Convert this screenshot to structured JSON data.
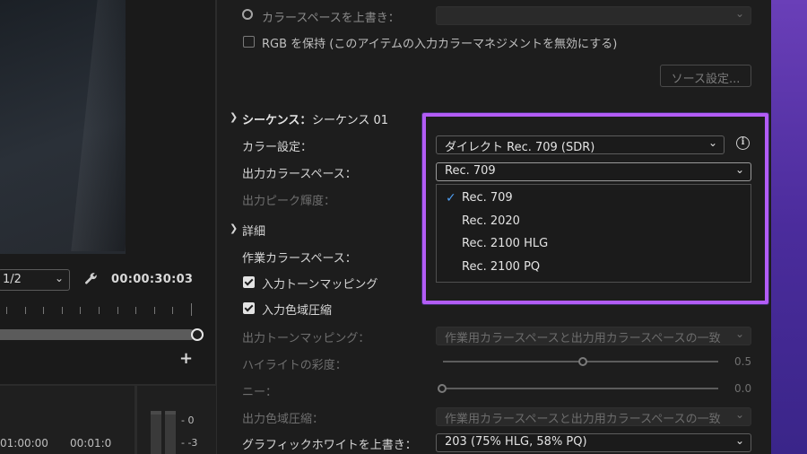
{
  "monitor": {
    "zoom_value": "1/2",
    "timecode": "00:00:30:03",
    "timeline_tc1": "01:00:00",
    "timeline_tc2": "00:01:0",
    "meter_label_0": "- 0",
    "meter_label_3": "- -3"
  },
  "source": {
    "override_label": "カラースペースを上書き：",
    "preserve_rgb_label": "RGB を保持 (このアイテムの入力カラーマネジメントを無効にする)",
    "source_settings_button": "ソース設定..."
  },
  "sequence": {
    "section_prefix": "シーケンス：",
    "section_name": "シーケンス 01",
    "color_setting_label": "カラー設定：",
    "color_setting_value": "ダイレクト Rec. 709 (SDR)",
    "output_space_label": "出力カラースペース：",
    "output_space_value": "Rec. 709",
    "peak_luminance_label": "出力ピーク輝度：",
    "output_space_options": [
      "Rec. 709",
      "Rec. 2020",
      "Rec. 2100 HLG",
      "Rec. 2100 PQ"
    ],
    "selected_option_index": 0
  },
  "details": {
    "section_label": "詳細",
    "working_space_label": "作業カラースペース：",
    "input_tone_mapping_label": "入力トーンマッピング",
    "input_gamut_label": "入力色域圧縮",
    "output_tone_mapping_label": "出力トーンマッピング：",
    "output_tone_mapping_value": "作業用カラースペースと出力用カラースペースの一致",
    "highlight_saturation_label": "ハイライトの彩度：",
    "highlight_saturation_value": "0.5",
    "knee_label": "ニー：",
    "knee_value": "0.0",
    "output_gamut_label": "出力色域圧縮：",
    "output_gamut_value": "作業用カラースペースと出力用カラースペースの一致",
    "graphics_white_label": "グラフィックホワイトを上書き：",
    "graphics_white_value": "203 (75% HLG, 58% PQ)"
  },
  "icons": {
    "chevron": "⌄",
    "check": "✓",
    "wrench": "🔧",
    "plus": "+",
    "info": "i"
  },
  "colors": {
    "highlight_frame": "#b25cf5",
    "accent_check": "#4d9cf0",
    "side_strip": "#5a34a8"
  }
}
